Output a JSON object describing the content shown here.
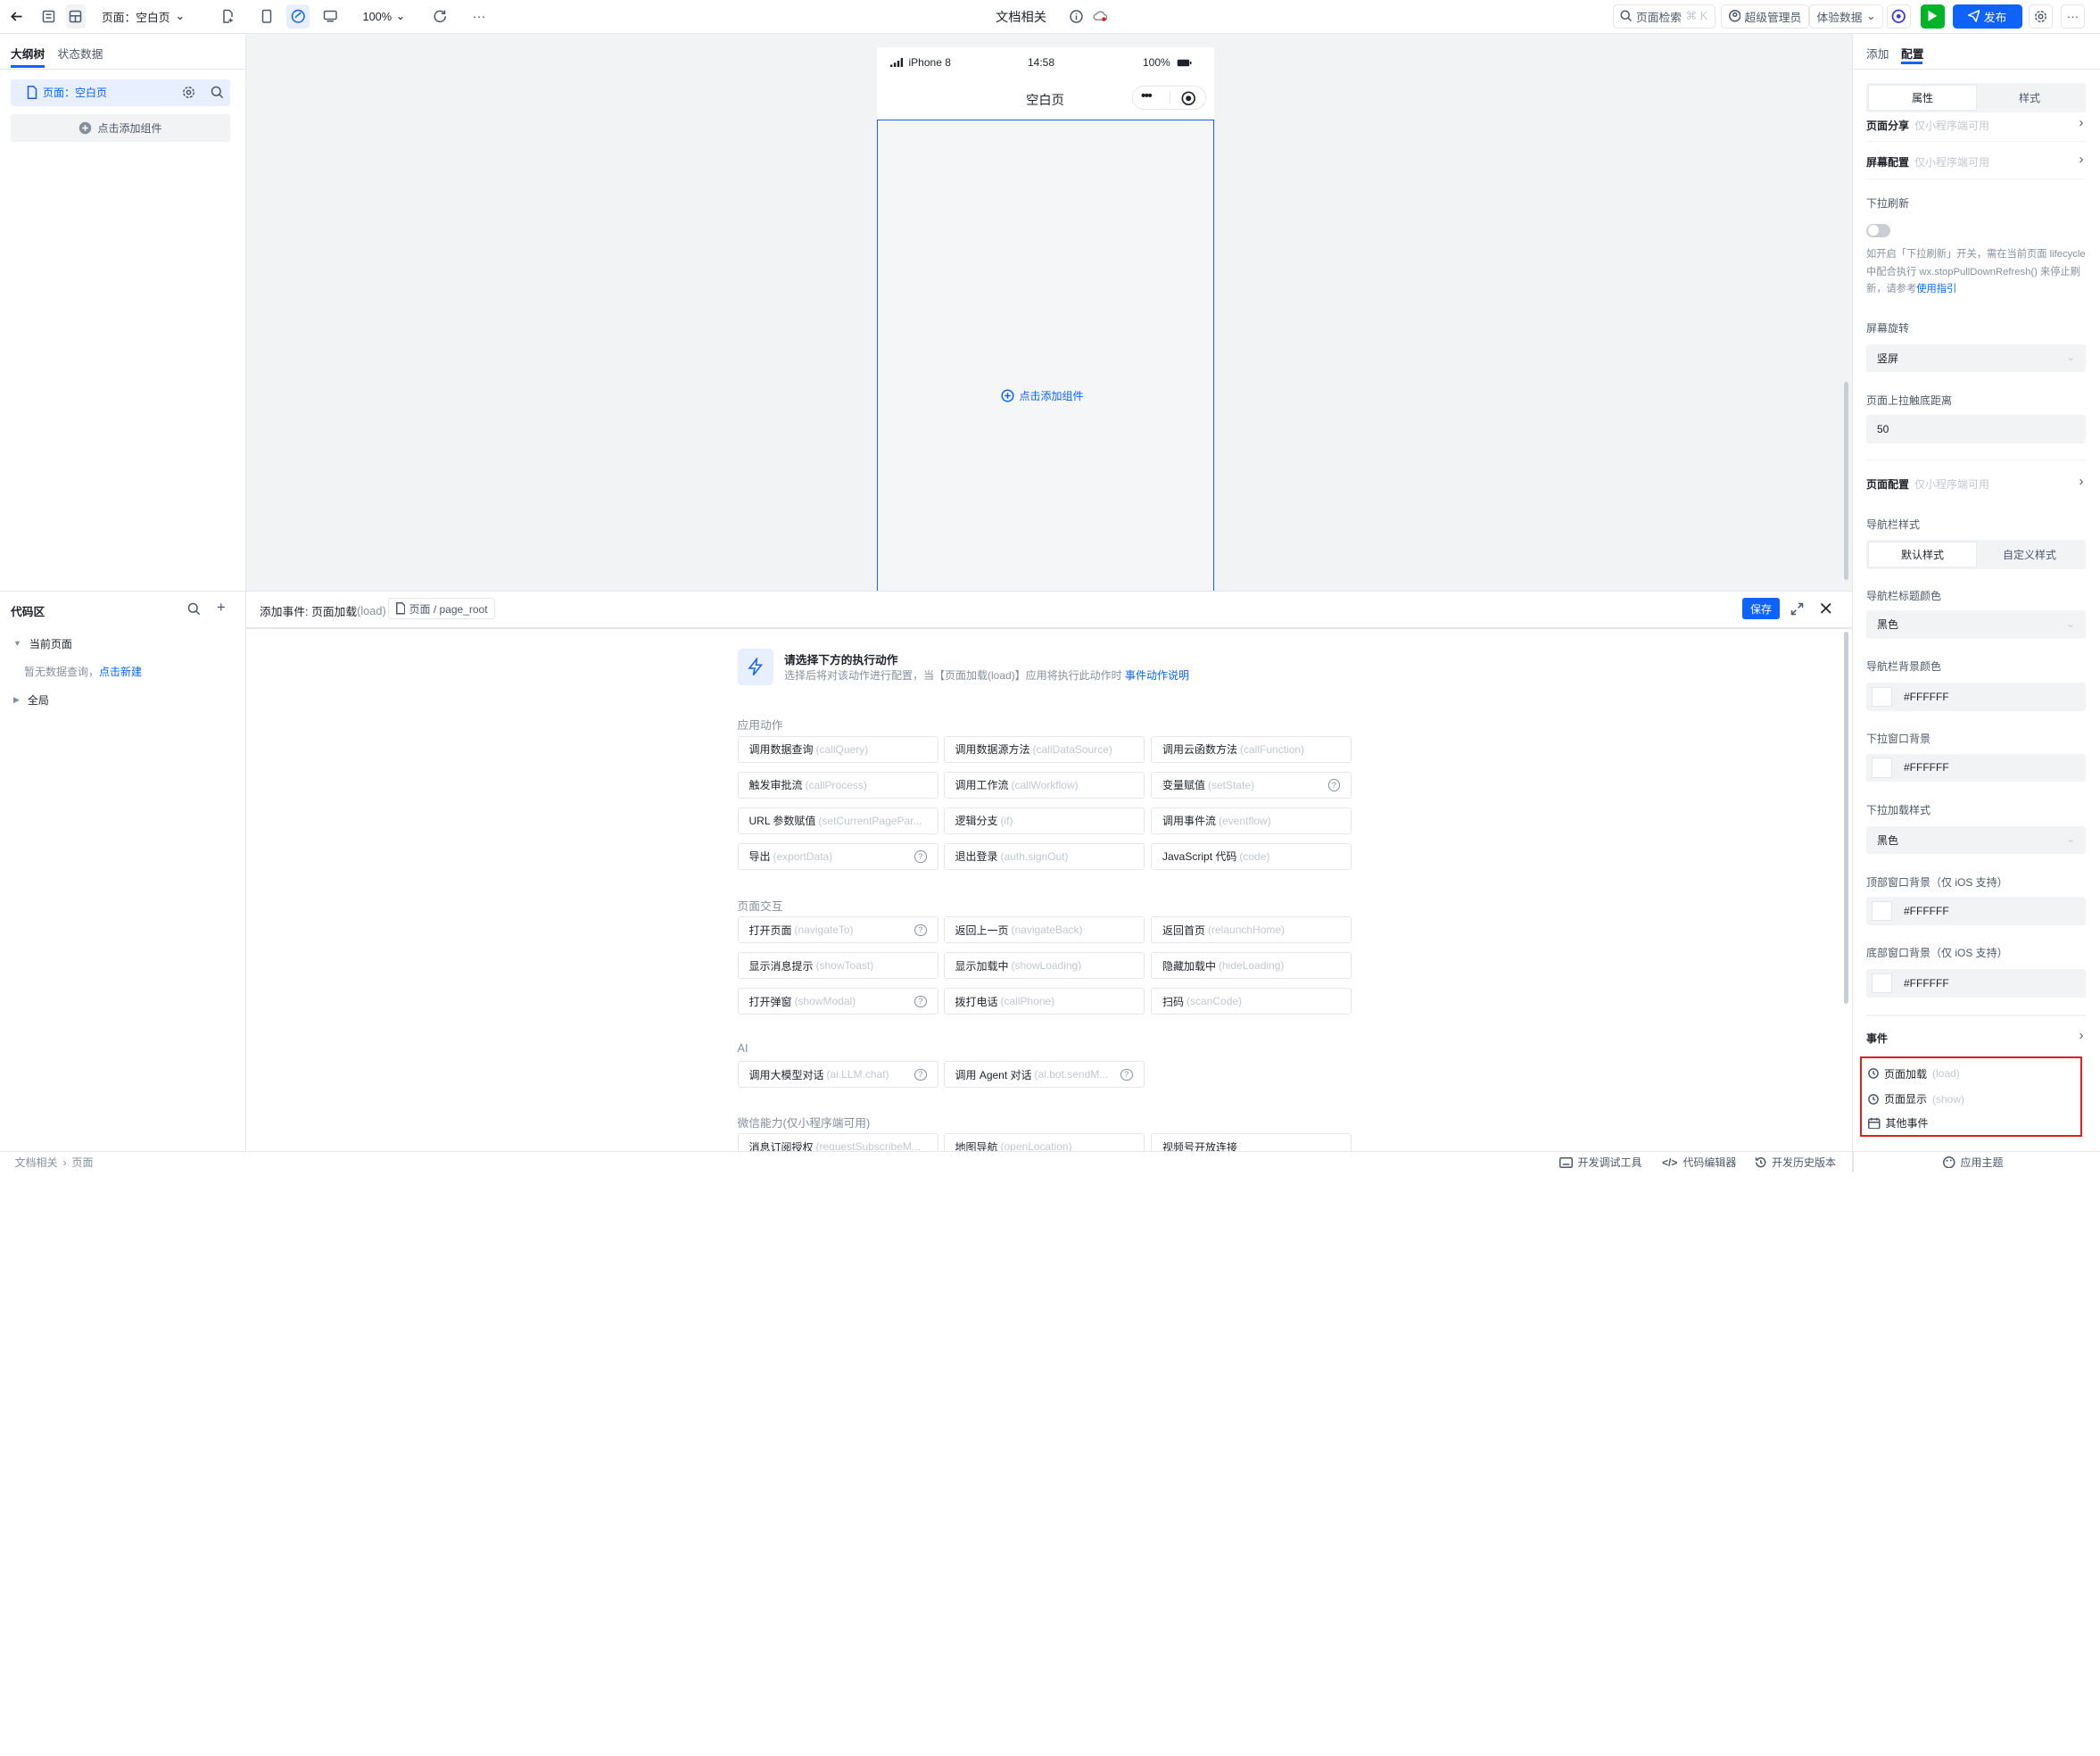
{
  "topbar": {
    "page_selector": "页面：空白页",
    "zoom": "100%",
    "doc_title": "文档相关",
    "search_label": "页面检索",
    "search_shortcut": "⌘ K",
    "user": "超级管理员",
    "env": "体验数据",
    "publish": "发布"
  },
  "left": {
    "tabs": [
      "大纲树",
      "状态数据"
    ],
    "page_node": "页面：空白页",
    "add_component": "点击添加组件",
    "code_title": "代码区",
    "current_page": "当前页面",
    "no_query": "暂无数据查询，",
    "new_link": "点击新建",
    "global": "全局"
  },
  "phone": {
    "signal": "iPhone 8",
    "time": "14:58",
    "battery": "100%",
    "title": "空白页",
    "add_component": "点击添加组件"
  },
  "event_panel": {
    "title": "添加事件: 页面加载",
    "title_suffix": "(load)",
    "path": "页面 / page_root",
    "save": "保存",
    "prompt_title": "请选择下方的执行动作",
    "prompt_desc": "选择后将对该动作进行配置，当【页面加载(load)】应用将执行此动作时",
    "prompt_link": "事件动作说明",
    "sections": [
      {
        "title": "应用动作",
        "items": [
          {
            "label": "调用数据查询",
            "en": "(callQuery)",
            "help": false
          },
          {
            "label": "调用数据源方法",
            "en": "(callDataSource)",
            "help": false
          },
          {
            "label": "调用云函数方法",
            "en": "(callFunction)",
            "help": false
          },
          {
            "label": "触发审批流",
            "en": "(callProcess)",
            "help": false
          },
          {
            "label": "调用工作流",
            "en": "(callWorkflow)",
            "help": false
          },
          {
            "label": "变量赋值",
            "en": "(setState)",
            "help": true
          },
          {
            "label": "URL 参数赋值",
            "en": "(setCurrentPagePar...",
            "help": false
          },
          {
            "label": "逻辑分支",
            "en": "(if)",
            "help": false
          },
          {
            "label": "调用事件流",
            "en": "(eventflow)",
            "help": false
          },
          {
            "label": "导出",
            "en": "(exportData)",
            "help": true
          },
          {
            "label": "退出登录",
            "en": "(auth.signOut)",
            "help": false
          },
          {
            "label": "JavaScript 代码",
            "en": "(code)",
            "help": false
          }
        ]
      },
      {
        "title": "页面交互",
        "items": [
          {
            "label": "打开页面",
            "en": "(navigateTo)",
            "help": true
          },
          {
            "label": "返回上一页",
            "en": "(navigateBack)",
            "help": false
          },
          {
            "label": "返回首页",
            "en": "(relaunchHome)",
            "help": false
          },
          {
            "label": "显示消息提示",
            "en": "(showToast)",
            "help": false
          },
          {
            "label": "显示加载中",
            "en": "(showLoading)",
            "help": false
          },
          {
            "label": "隐藏加载中",
            "en": "(hideLoading)",
            "help": false
          },
          {
            "label": "打开弹窗",
            "en": "(showModal)",
            "help": true
          },
          {
            "label": "拨打电话",
            "en": "(callPhone)",
            "help": false
          },
          {
            "label": "扫码",
            "en": "(scanCode)",
            "help": false
          }
        ]
      },
      {
        "title": "AI",
        "items": [
          {
            "label": "调用大模型对话",
            "en": "(ai.LLM.chat)",
            "help": true
          },
          {
            "label": "调用 Agent 对话",
            "en": "(ai.bot.sendM...",
            "help": true
          }
        ]
      },
      {
        "title": "微信能力(仅小程序端可用)",
        "items": [
          {
            "label": "消息订阅授权",
            "en": "(requestSubscribeM...",
            "help": false
          },
          {
            "label": "地图导航",
            "en": "(openLocation)",
            "help": false
          },
          {
            "label": "视频号开放连接",
            "en": "",
            "help": false
          }
        ]
      }
    ]
  },
  "right": {
    "tabs": [
      "添加",
      "配置"
    ],
    "seg": [
      "属性",
      "样式"
    ],
    "page_share": "页面分享",
    "miniapp_only": "仅小程序端可用",
    "screen_config": "屏幕配置",
    "pull_refresh": "下拉刷新",
    "pull_refresh_desc": "如开启「下拉刷新」开关，需在当前页面 lifecycle 中配合执行 wx.stopPullDownRefresh() 来停止刷新，请参考",
    "pull_refresh_link": "使用指引",
    "rotate_label": "屏幕旋转",
    "rotate_value": "竖屏",
    "reach_bottom_label": "页面上拉触底距离",
    "reach_bottom_value": "50",
    "page_config": "页面配置",
    "nav_style_label": "导航栏样式",
    "nav_style_opts": [
      "默认样式",
      "自定义样式"
    ],
    "nav_title_color_label": "导航栏标题颜色",
    "nav_title_color": "黑色",
    "nav_bg_label": "导航栏背景颜色",
    "nav_bg": "#FFFFFF",
    "pull_bg_label": "下拉窗口背景",
    "pull_bg": "#FFFFFF",
    "pull_style_label": "下拉加载样式",
    "pull_style": "黑色",
    "top_bg_label": "顶部窗口背景（仅 iOS 支持）",
    "top_bg": "#FFFFFF",
    "bottom_bg_label": "底部窗口背景（仅 iOS 支持）",
    "bottom_bg": "#FFFFFF",
    "events_title": "事件",
    "events": [
      {
        "label": "页面加载",
        "en": "(load)"
      },
      {
        "label": "页面显示",
        "en": "(show)"
      },
      {
        "label": "其他事件",
        "en": ""
      }
    ]
  },
  "footer": {
    "crumbs": [
      "文档相关",
      "页面"
    ],
    "debug": "开发调试工具",
    "code_editor": "代码编辑器",
    "history": "开发历史版本",
    "theme": "应用主题"
  },
  "colors": {
    "primary": "#0f62fe",
    "green": "#00b42a",
    "highlight": "#e02020"
  }
}
